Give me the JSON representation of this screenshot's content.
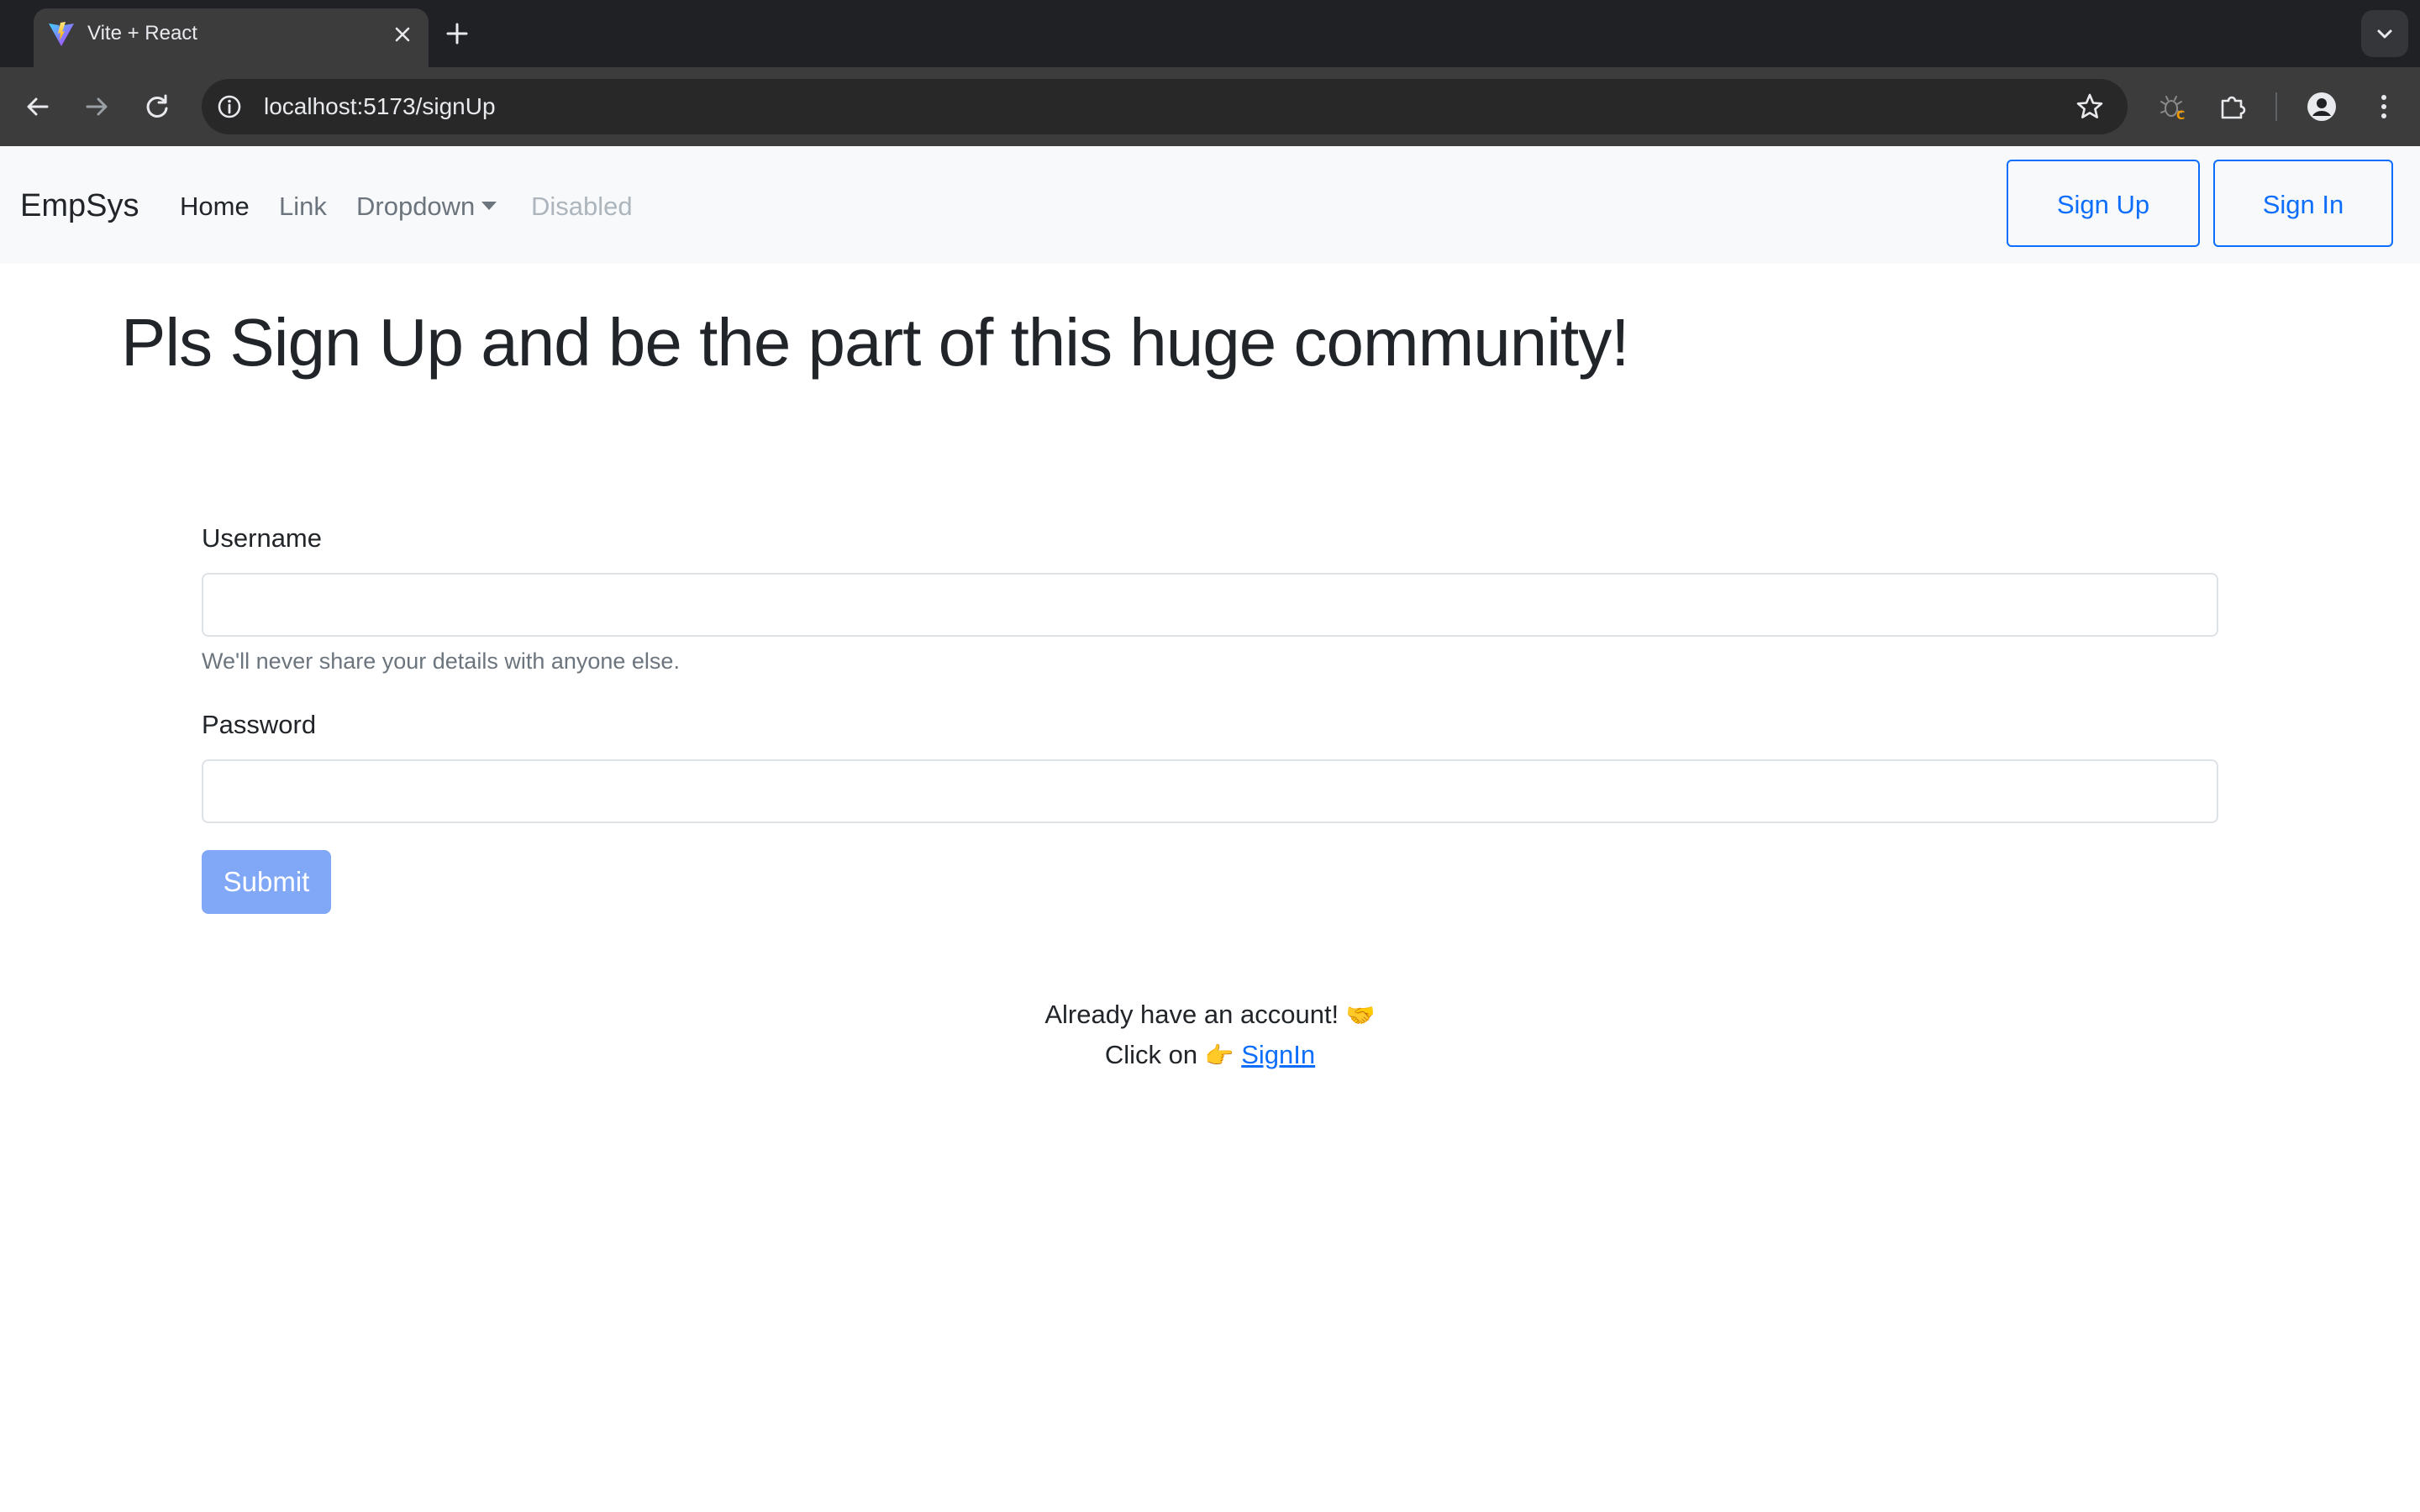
{
  "browser": {
    "tab_title": "Vite + React",
    "tab_close_icon": "close-icon",
    "new_tab_symbol": "+",
    "url": "localhost:5173/signUp"
  },
  "navbar": {
    "brand": "EmpSys",
    "links": {
      "home": "Home",
      "link": "Link",
      "dropdown": "Dropdown",
      "disabled": "Disabled"
    },
    "sign_up_label": "Sign Up",
    "sign_in_label": "Sign In"
  },
  "main": {
    "heading": "Pls Sign Up and be the part of this huge community!",
    "username_label": "Username",
    "username_value": "",
    "username_help": "We'll never share your details with anyone else.",
    "password_label": "Password",
    "password_value": "",
    "submit_label": "Submit",
    "already_text": "Already have an account!",
    "handshake_emoji": "🤝",
    "click_on_text": "Click on",
    "pointing_emoji": "👉",
    "signin_link_label": "SignIn"
  },
  "colors": {
    "primary": "#0d6efd",
    "submit_disabled": "#80a8f7",
    "navbar_bg": "#f8f9fa",
    "browser_dark": "#202124"
  }
}
